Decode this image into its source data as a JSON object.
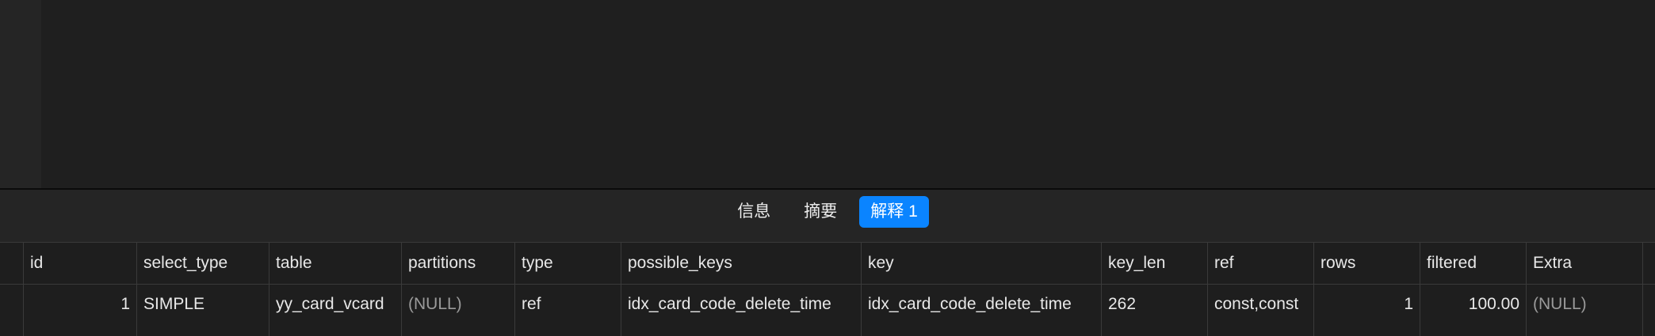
{
  "tabs": [
    {
      "label": "信息",
      "active": false
    },
    {
      "label": "摘要",
      "active": false
    },
    {
      "label": "解释 1",
      "active": true
    }
  ],
  "colors": {
    "accent": "#0a84ff",
    "null_text": "#9a9a9a"
  },
  "grid": {
    "columns": [
      "id",
      "select_type",
      "table",
      "partitions",
      "type",
      "possible_keys",
      "key",
      "key_len",
      "ref",
      "rows",
      "filtered",
      "Extra"
    ],
    "rows": [
      {
        "id": "1",
        "select_type": "SIMPLE",
        "table": "yy_card_vcard",
        "partitions": "(NULL)",
        "type": "ref",
        "possible_keys": "idx_card_code_delete_time",
        "key": "idx_card_code_delete_time",
        "key_len": "262",
        "ref": "const,const",
        "rows": "1",
        "filtered": "100.00",
        "Extra": "(NULL)"
      }
    ]
  }
}
